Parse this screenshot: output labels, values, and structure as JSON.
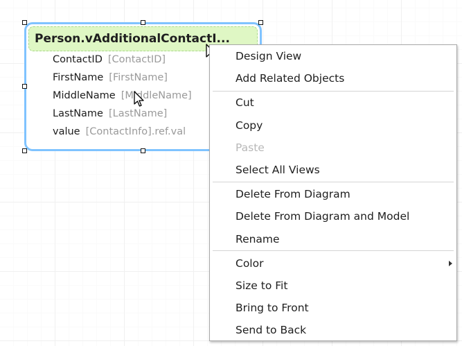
{
  "entity": {
    "title": "Person.vAdditionalContactI...",
    "fields": [
      {
        "name": "ContactID",
        "source": "[ContactID]"
      },
      {
        "name": "FirstName",
        "source": "[FirstName]"
      },
      {
        "name": "MiddleName",
        "source": "[MiddleName]"
      },
      {
        "name": "LastName",
        "source": "[LastName]"
      },
      {
        "name": "value",
        "source": "[ContactInfo].ref.val"
      }
    ]
  },
  "context_menu": {
    "items": [
      {
        "label": "Design View"
      },
      {
        "label": "Add Related Objects"
      },
      {
        "label": "Cut"
      },
      {
        "label": "Copy"
      },
      {
        "label": "Paste"
      },
      {
        "label": "Select All Views"
      },
      {
        "label": "Delete From Diagram"
      },
      {
        "label": "Delete From Diagram and Model"
      },
      {
        "label": "Rename"
      },
      {
        "label": "Color"
      },
      {
        "label": "Size to Fit"
      },
      {
        "label": "Bring to Front"
      },
      {
        "label": "Send to Back"
      }
    ]
  },
  "colors": {
    "selection_border": "#7fc3ff",
    "header_fill": "#dff7c4",
    "disabled_text": "#b8b8b8"
  }
}
